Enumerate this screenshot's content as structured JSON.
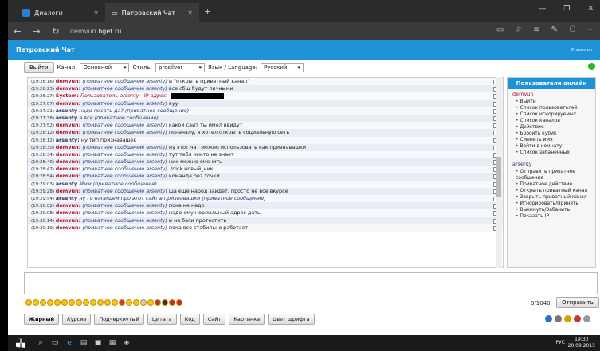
{
  "browser": {
    "tab1": "Диалоги",
    "tab2": "Петровский Чат",
    "url_prefix": "demvun.",
    "url_host": "bget.ru"
  },
  "page": {
    "title": "Петровский Чат",
    "logo_small": "© demvun"
  },
  "toolbar": {
    "exit": "Выйти",
    "channel_label": "Канал:",
    "channel_value": "Основной",
    "style_label": "Стиль:",
    "style_value": "prosilver",
    "lang_label": "Язык / Language:",
    "lang_value": "Русский"
  },
  "messages": [
    {
      "ts": "(19:26:16)",
      "nick": "demvun:",
      "cls": "",
      "pm": "(приватное сообщение arsenty)",
      "text": " и \"открыть приватный канал\""
    },
    {
      "ts": "(19:26:23)",
      "nick": "demvun:",
      "cls": "",
      "pm": "(приватное сообщение arsenty)",
      "text": " все сбщ будут личными"
    },
    {
      "ts": "(19:26:27)",
      "nick": "System:",
      "cls": "sys",
      "pm": "Пользователь arsenty - IP адрес:",
      "text": ""
    },
    {
      "ts": "(19:27:07)",
      "nick": "demvun:",
      "cls": "",
      "pm": "(приватное сообщение arsenty)",
      "text": " ауу"
    },
    {
      "ts": "(19:27:21)",
      "nick": "arsenty",
      "cls": "a",
      "pm": "надо писать да? (приватное сообщение)",
      "text": ""
    },
    {
      "ts": "(19:27:38)",
      "nick": "arsenty",
      "cls": "a",
      "pm": "а все (приватное сообщение)",
      "text": ""
    },
    {
      "ts": "(19:27:52)",
      "nick": "demvun:",
      "cls": "",
      "pm": "(приватное сообщение arsenty)",
      "text": " какой сайт ты имел ввиду?"
    },
    {
      "ts": "(19:28:12)",
      "nick": "demvun:",
      "cls": "",
      "pm": "(приватное сообщение arsenty)",
      "text": " поначалу, я хотел открыть социальную сеть"
    },
    {
      "ts": "(19:28:12)",
      "nick": "arsenty:",
      "cls": "a",
      "pm": "",
      "text": " ну тип признавашек"
    },
    {
      "ts": "(19:28:30)",
      "nick": "demvun:",
      "cls": "",
      "pm": "(приватное сообщение arsenty)",
      "text": " ну этот чат можно использовать как признавашки"
    },
    {
      "ts": "(19:28:34)",
      "nick": "demvun:",
      "cls": "",
      "pm": "(приватное сообщение arsenty)",
      "text": " тут тебя никто не знает"
    },
    {
      "ts": "(19:28:40)",
      "nick": "demvun:",
      "cls": "",
      "pm": "(приватное сообщение arsenty)",
      "text": " ник можно сменить"
    },
    {
      "ts": "(19:28:47)",
      "nick": "demvun:",
      "cls": "",
      "pm": "(приватное сообщение arsenty)",
      "text": " ./nick новый_ник"
    },
    {
      "ts": "(19:28:54)",
      "nick": "demvun:",
      "cls": "",
      "pm": "(приватное сообщение arsenty)",
      "text": " команда без точки"
    },
    {
      "ts": "(19:29:03)",
      "nick": "arsenty",
      "cls": "a",
      "pm": "Ммм (приватное сообщение)",
      "text": ""
    },
    {
      "ts": "(19:29:28)",
      "nick": "demvun:",
      "cls": "",
      "pm": "(приватное сообщение arsenty)",
      "text": " ща еще народ зайдет, просто не все вкурсе"
    },
    {
      "ts": "(19:29:54)",
      "nick": "arsenty",
      "cls": "a",
      "pm": "ну го напишем про этот сайт в признавашки (приватное сообщение)",
      "text": ""
    },
    {
      "ts": "(19:30:02)",
      "nick": "demvun:",
      "cls": "",
      "pm": "(приватное сообщение arsenty)",
      "text": " пока не надо"
    },
    {
      "ts": "(19:30:08)",
      "nick": "demvun:",
      "cls": "",
      "pm": "(приватное сообщение arsenty)",
      "text": " надо ему нормальный адрес дать"
    },
    {
      "ts": "(19:30:14)",
      "nick": "demvun:",
      "cls": "",
      "pm": "(приватное сообщение arsenty)",
      "text": " и на баги протестить"
    },
    {
      "ts": "(19:30:19)",
      "nick": "demvun:",
      "cls": "",
      "pm": "(приватное сообщение arsenty)",
      "text": " пока все стабильно работает"
    }
  ],
  "users": {
    "header": "Пользователи онлайн",
    "u1": "demvun",
    "u1_menu": [
      "Выйти",
      "Список пользователей",
      "Список игнорируемых",
      "Список каналов",
      "Действие",
      "Бросить кубик",
      "Сменить имя",
      "Войти в комнату",
      "Список забаненных"
    ],
    "u2": "arsenty",
    "u2_menu": [
      "Отправить приватное сообщение",
      "Приватное действие",
      "Открыть приватный канал",
      "Закрыть приватный канал",
      "Игнорировать/Принять",
      "Выкинуть/Забанить",
      "Показать IP"
    ]
  },
  "input": {
    "counter": "0/1040",
    "send": "Отправить"
  },
  "format": [
    "Жирный",
    "Курсив",
    "Подчеркнутый",
    "Цитата",
    "Код",
    "Сайт",
    "Картинка",
    "Цвет шрифта"
  ],
  "taskbar": {
    "lang": "РУС",
    "time": "19:30",
    "date": "20.09.2015"
  },
  "colors": {
    "accent": "#1e92d6",
    "nick": "#b0112b"
  }
}
